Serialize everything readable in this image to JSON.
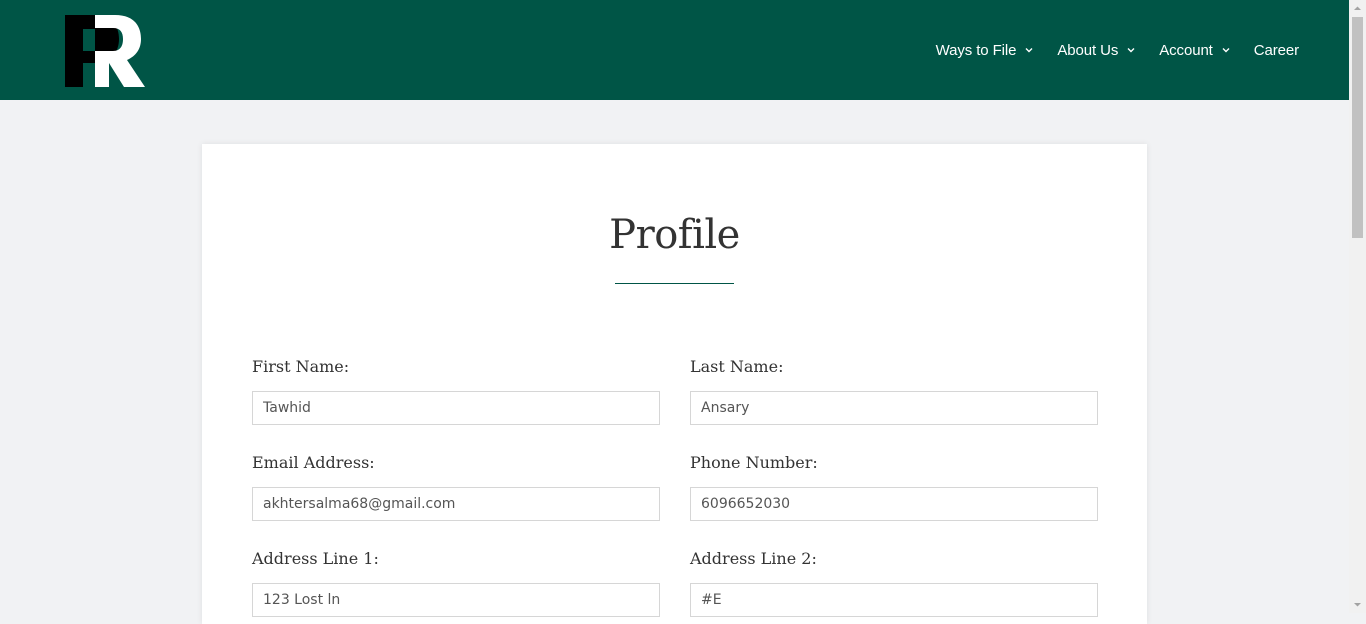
{
  "header": {
    "logo_text": "PR",
    "brand_color": "#005546",
    "nav": [
      {
        "label": "Ways to File",
        "has_dropdown": true
      },
      {
        "label": "About Us",
        "has_dropdown": true
      },
      {
        "label": "Account",
        "has_dropdown": true
      },
      {
        "label": "Career",
        "has_dropdown": false
      }
    ]
  },
  "profile": {
    "title": "Profile",
    "fields": {
      "first_name": {
        "label": "First Name:",
        "value": "Tawhid"
      },
      "last_name": {
        "label": "Last Name:",
        "value": "Ansary"
      },
      "email": {
        "label": "Email Address:",
        "value": "akhtersalma68@gmail.com"
      },
      "phone": {
        "label": "Phone Number:",
        "value": "6096652030"
      },
      "address1": {
        "label": "Address Line 1:",
        "value": "123 Lost ln"
      },
      "address2": {
        "label": "Address Line 2:",
        "value": "#E"
      }
    }
  }
}
